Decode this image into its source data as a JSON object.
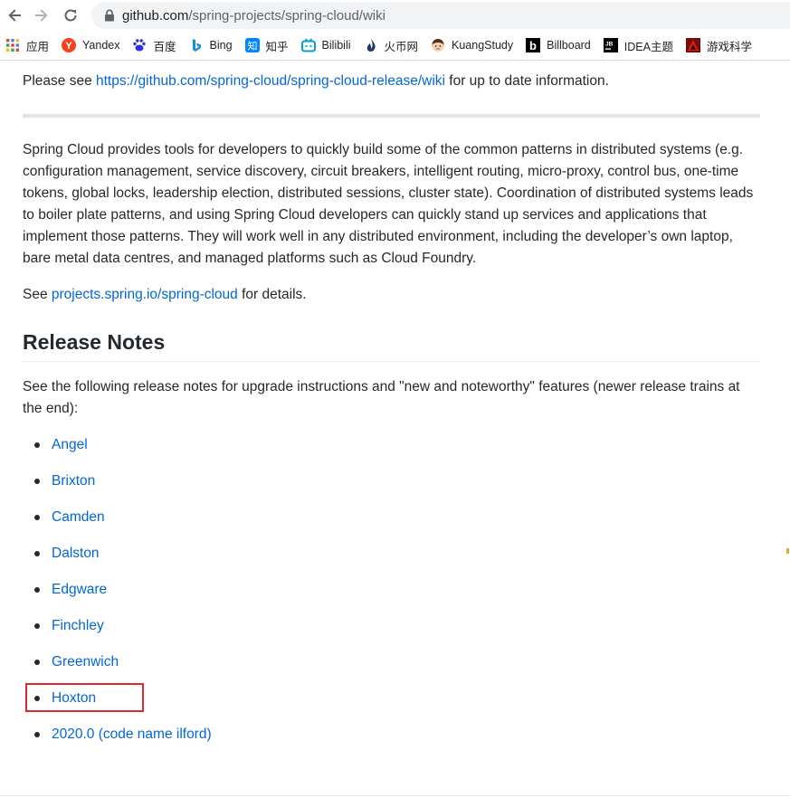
{
  "browser": {
    "url_host": "github.com",
    "url_path": "/spring-projects/spring-cloud/wiki",
    "bookmarks": [
      {
        "label": "应用",
        "icon": "apps-grid-icon"
      },
      {
        "label": "Yandex",
        "icon": "yandex-icon"
      },
      {
        "label": "百度",
        "icon": "baidu-icon"
      },
      {
        "label": "Bing",
        "icon": "bing-icon"
      },
      {
        "label": "知乎",
        "icon": "zhihu-icon"
      },
      {
        "label": "Bilibili",
        "icon": "bilibili-icon"
      },
      {
        "label": "火币网",
        "icon": "huobi-icon"
      },
      {
        "label": "KuangStudy",
        "icon": "kuangstudy-icon"
      },
      {
        "label": "Billboard",
        "icon": "billboard-icon"
      },
      {
        "label": "IDEA主题",
        "icon": "jetbrains-icon"
      },
      {
        "label": "游戏科学",
        "icon": "gamescience-icon"
      }
    ]
  },
  "page": {
    "intro_prefix": "Please see ",
    "intro_link": "https://github.com/spring-cloud/spring-cloud-release/wiki",
    "intro_suffix": " for up to date information.",
    "description": "Spring Cloud provides tools for developers to quickly build some of the common patterns in distributed systems (e.g. configuration management, service discovery, circuit breakers, intelligent routing, micro-proxy, control bus, one-time tokens, global locks, leadership election, distributed sessions, cluster state). Coordination of distributed systems leads to boiler plate patterns, and using Spring Cloud developers can quickly stand up services and applications that implement those patterns. They will work well in any distributed environment, including the developer’s own laptop, bare metal data centres, and managed platforms such as Cloud Foundry.",
    "see_prefix": "See ",
    "see_link": "projects.spring.io/spring-cloud",
    "see_suffix": " for details.",
    "heading": "Release Notes",
    "release_intro": "See the following release notes for upgrade instructions and \"new and noteworthy\" features (newer release trains at the end):",
    "releases": [
      "Angel",
      "Brixton",
      "Camden",
      "Dalston",
      "Edgware",
      "Finchley",
      "Greenwich",
      "Hoxton",
      "2020.0 (code name ilford)"
    ]
  },
  "colors": {
    "link": "#0366d6",
    "highlight_box": "#e0272b"
  }
}
